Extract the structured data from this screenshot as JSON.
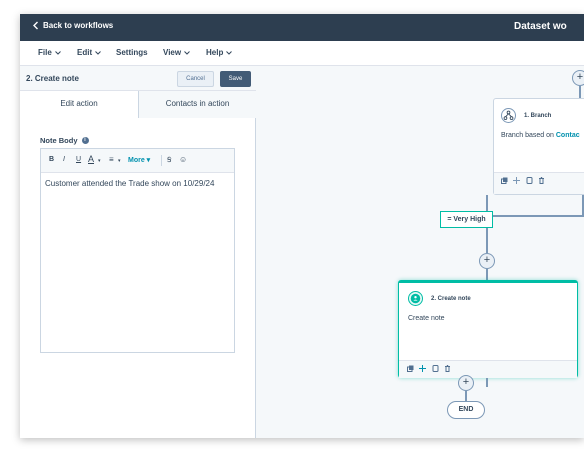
{
  "topbar": {
    "back_label": "Back to workflows",
    "workflow_title": "Dataset wo"
  },
  "menu": {
    "file": "File",
    "edit": "Edit",
    "settings": "Settings",
    "view": "View",
    "help": "Help"
  },
  "panel": {
    "title": "2. Create note",
    "cancel_label": "Cancel",
    "save_label": "Save",
    "tabs": [
      {
        "label": "Edit action"
      },
      {
        "label": "Contacts in action"
      }
    ],
    "field_label": "Note Body",
    "toolbar": {
      "bold": "B",
      "italic": "I",
      "underline": "U",
      "text_color": "A",
      "list": "≡",
      "more": "More",
      "clear": "Ꞩ",
      "emoji": "☺"
    },
    "note_body": "Customer attended the Trade show on 10/29/24"
  },
  "canvas": {
    "branch_card": {
      "title": "1. Branch",
      "desc_prefix": "Branch based on ",
      "desc_link": "Contac"
    },
    "branch_label": "= Very High",
    "note_card": {
      "title": "2. Create note",
      "desc": "Create note"
    },
    "plus_symbol": "+",
    "end_label": "END"
  },
  "colors": {
    "topbar": "#2d3e50",
    "accent_teal": "#00bda5",
    "link": "#0091ae",
    "save_button": "#425b76"
  }
}
